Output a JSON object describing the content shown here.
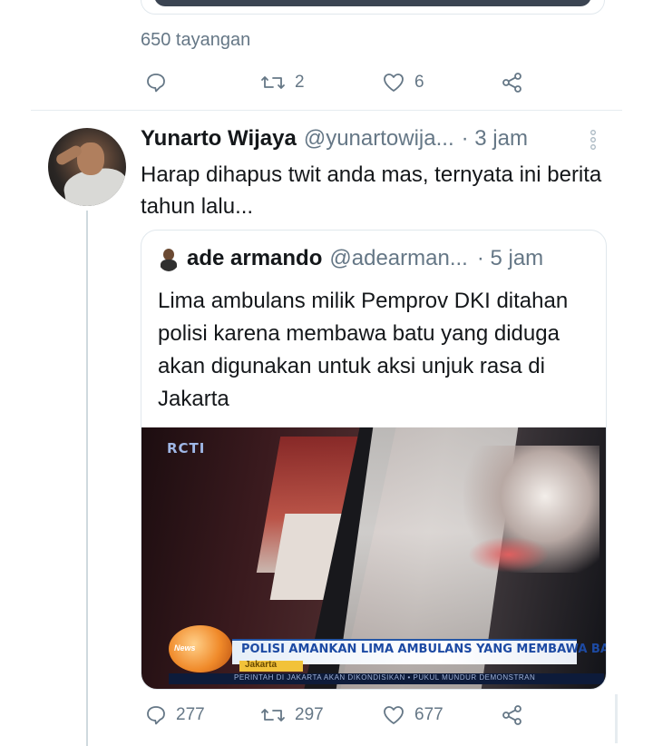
{
  "previous_tweet": {
    "views": "650 tayangan",
    "actions": {
      "reply_count": "",
      "retweet_count": "2",
      "like_count": "6"
    }
  },
  "tweet": {
    "author_name": "Yunarto Wijaya",
    "author_handle": "@yunartowija...",
    "time": "· 3 jam",
    "text": "Harap dihapus twit anda mas, ternyata ini berita tahun lalu...",
    "quoted": {
      "author_name": "ade armando",
      "author_handle": "@adearman...",
      "time": "· 5 jam",
      "text": "Lima ambulans milik Pemprov DKI ditahan polisi karena membawa batu yang diduga akan digunakan untuk aksi unjuk rasa di Jakarta",
      "video": {
        "channel_logo": "RCTI",
        "program_logo": "News",
        "headline": "POLISI AMANKAN LIMA AMBULANS YANG MEMBAWA BATU",
        "location": "Jakarta",
        "ticker": "PERINTAH DI JAKARTA AKAN DIKONDISIKAN  •  PUKUL MUNDUR DEMONSTRAN"
      }
    },
    "actions": {
      "reply_count": "277",
      "retweet_count": "297",
      "like_count": "677"
    }
  },
  "icons": {
    "reply": "speech-bubble-icon",
    "retweet": "retweet-arrows-icon",
    "like": "heart-icon",
    "share": "share-icon",
    "more": "vertical-dots-icon"
  },
  "colors": {
    "secondary_text": "#657786",
    "border": "#e1e8ed",
    "thread_line": "#cfd9de"
  }
}
